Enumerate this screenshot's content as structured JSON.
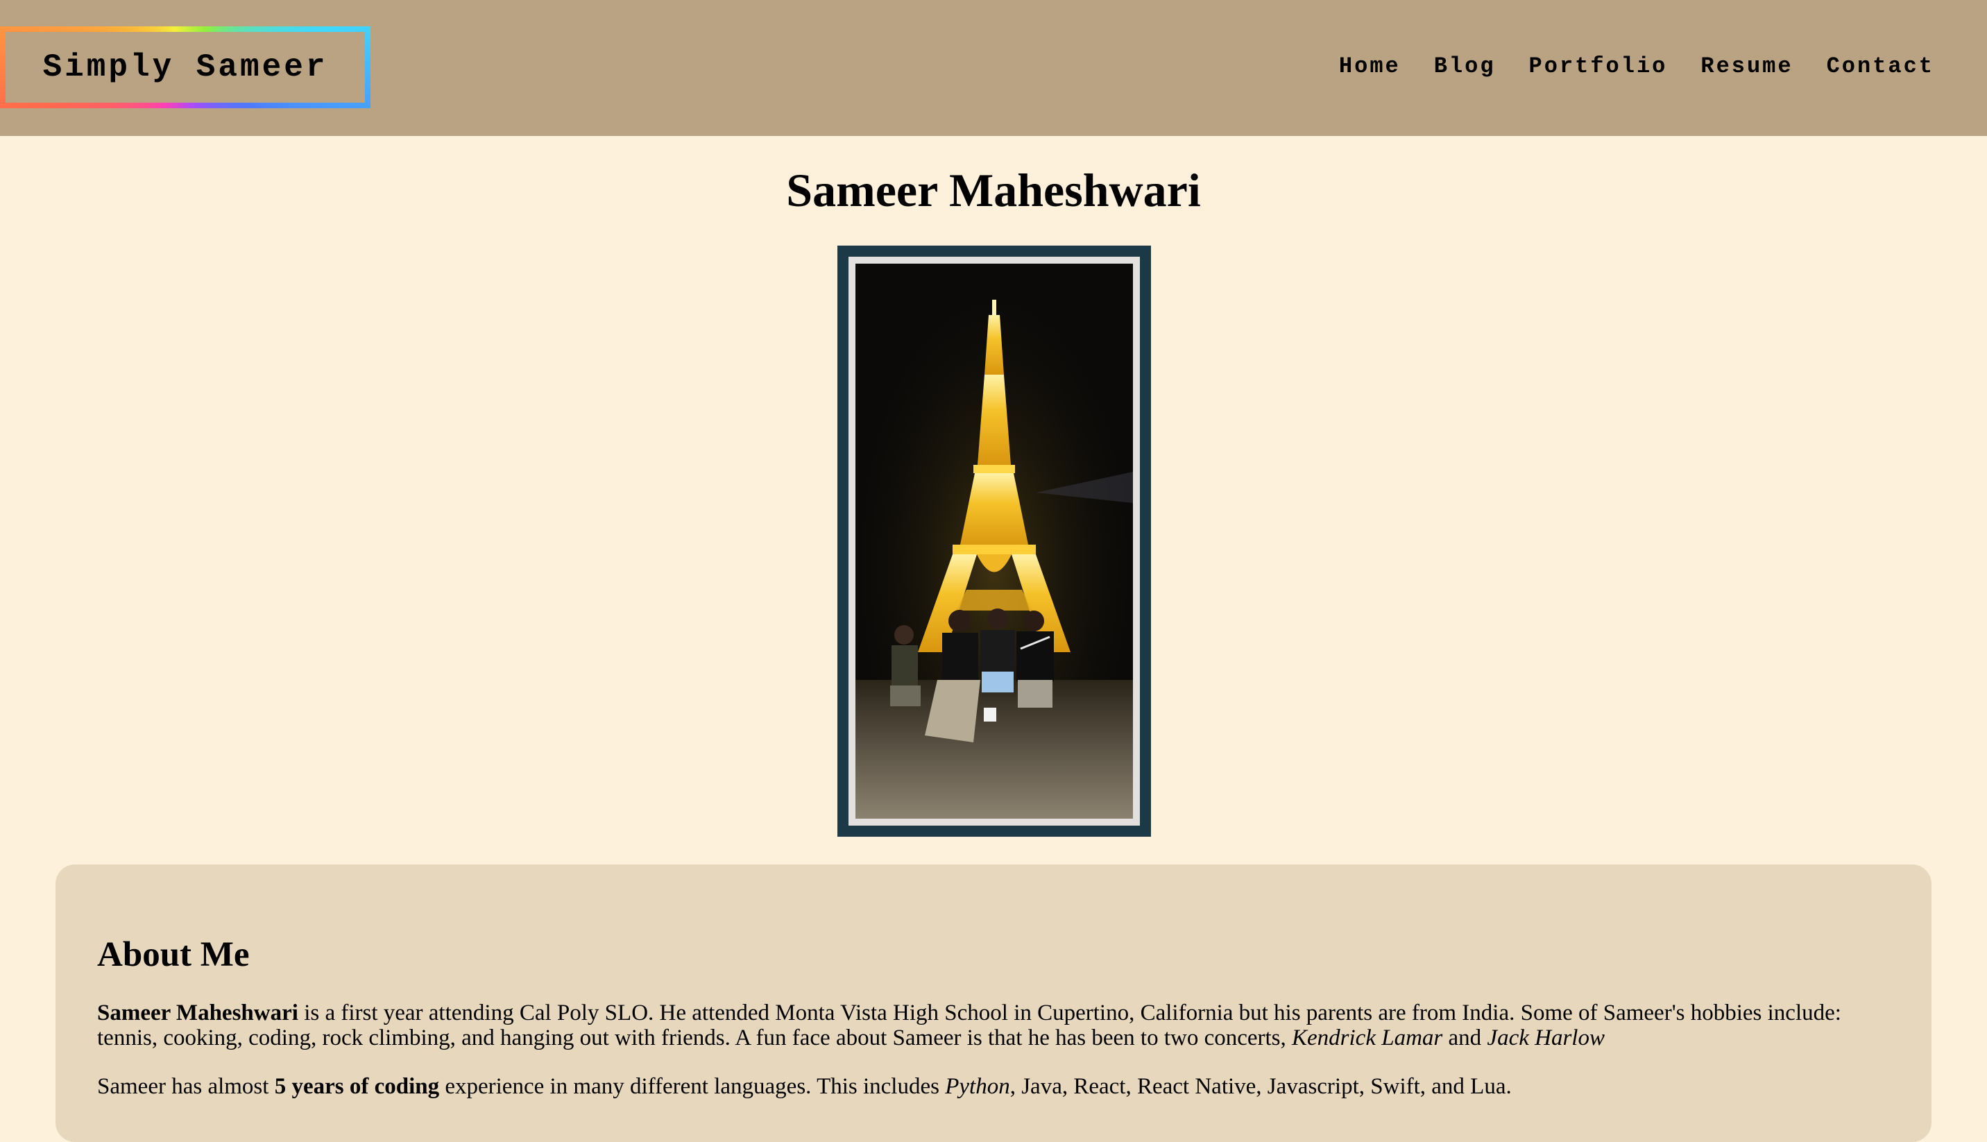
{
  "header": {
    "logo": "Simply Sameer",
    "nav": [
      "Home",
      "Blog",
      "Portfolio",
      "Resume",
      "Contact"
    ]
  },
  "main": {
    "title": "Sameer Maheshwari",
    "photo_description_icon": "eiffel-tower-photo"
  },
  "about": {
    "heading": "About Me",
    "p1": {
      "name": "Sameer Maheshwari",
      "text1": " is a first year attending Cal Poly SLO. He attended Monta Vista High School in Cupertino, California but his parents are from India. Some of Sameer's hobbies include: tennis, cooking, coding, rock climbing, and hanging out with friends. A fun face about Sameer is that he has been to two concerts, ",
      "concert1": "Kendrick Lamar",
      "and": " and ",
      "concert2": "Jack Harlow"
    },
    "p2": {
      "text1": "Sameer has almost ",
      "bold": "5 years of coding",
      "text2": " experience in many different languages. This includes ",
      "lang1": "Python",
      "text3": ", Java, React, React Native, Javascript, Swift, and Lua."
    }
  },
  "colors": {
    "header_bg": "#b9a383",
    "page_bg": "#fdf1dc",
    "card_bg": "#e7d8bd",
    "photo_frame": "#1c3947"
  }
}
